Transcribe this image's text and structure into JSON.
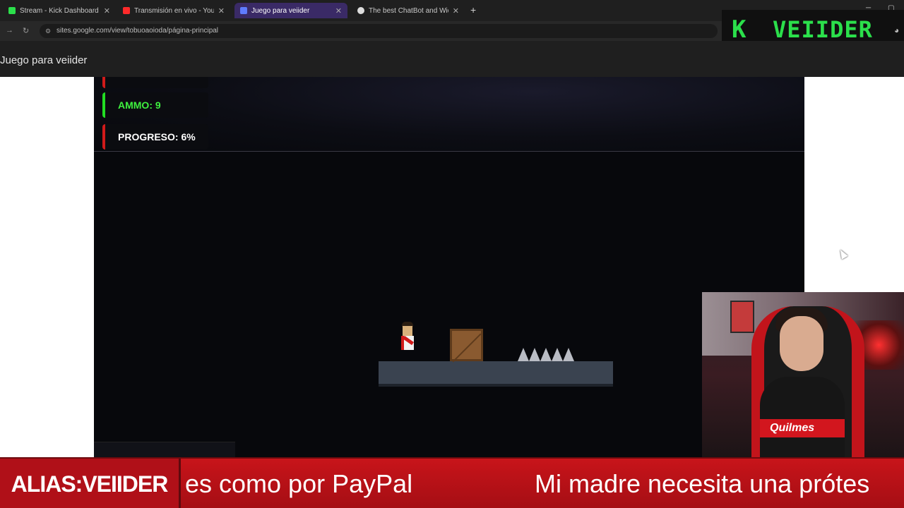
{
  "browser": {
    "tabs": [
      {
        "label": "Stream - Kick Dashboard",
        "favicon_color": "#2be04b"
      },
      {
        "label": "Transmisión en vivo - YouTube",
        "favicon_color": "#ff2a2a"
      },
      {
        "label": "Juego para veiider",
        "favicon_color": "#5f7cff"
      },
      {
        "label": "The best ChatBot and Widgets",
        "favicon_color": "#dddddd"
      }
    ],
    "url": "sites.google.com/view/tobuoaoioda/página-principal"
  },
  "logo": {
    "k": "K",
    "name": "VEIIDER"
  },
  "site": {
    "title": "Juego para veiider"
  },
  "hud": {
    "ammo": "AMMO: 9",
    "progress": "PROGRESO: 6%",
    "progress_value": 6
  },
  "webcam": {
    "shirt_text": "Quilmes"
  },
  "banner": {
    "alias": "ALIAS:VEIIDER",
    "ticker_1": "es como por PayPal",
    "ticker_2": "Mi madre necesita una prótes"
  },
  "colors": {
    "accent_green": "#2be04b",
    "hud_red": "#d11a1a",
    "banner_red": "#c8141a"
  }
}
